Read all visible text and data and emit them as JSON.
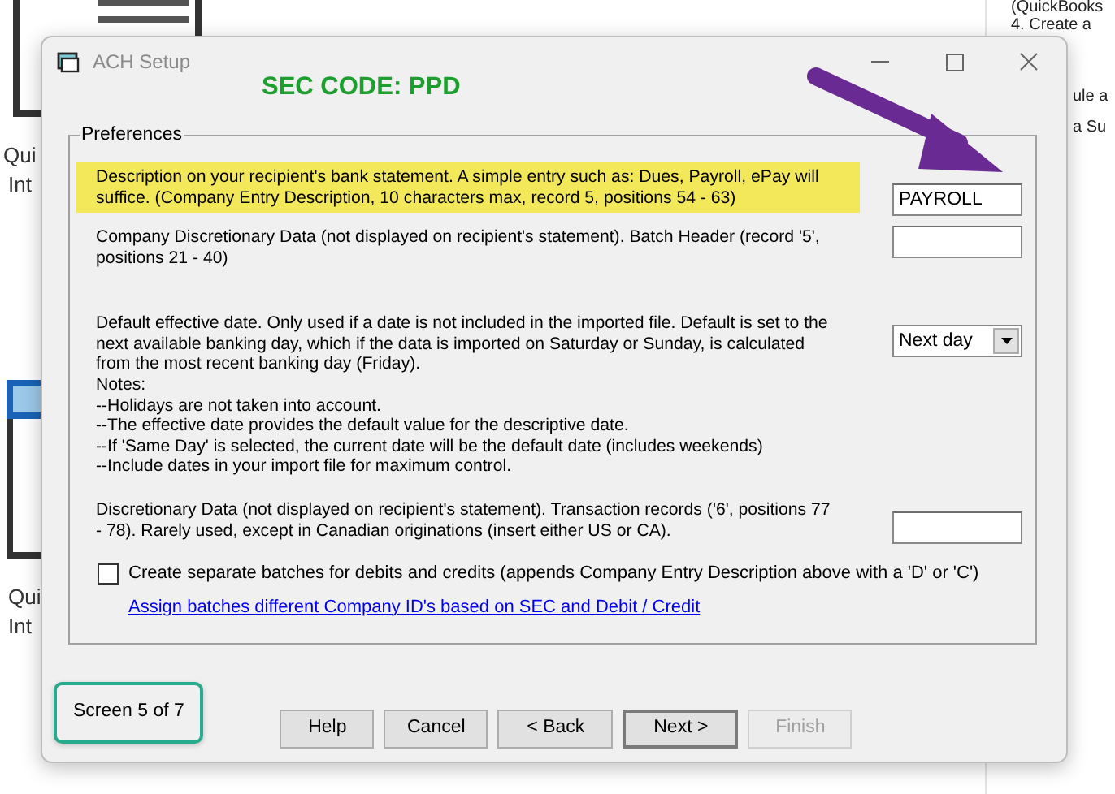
{
  "background_page": {
    "left_texts": [
      {
        "text": "Qui"
      },
      {
        "text": "Int"
      },
      {
        "text": "Qui"
      },
      {
        "text": "Int"
      }
    ],
    "right_texts": [
      {
        "text": "(QuickBooks"
      },
      {
        "text": "4. Create a"
      },
      {
        "text": "ule a"
      },
      {
        "text": "a Su"
      }
    ]
  },
  "window": {
    "title": "ACH Setup",
    "annotation": "SEC CODE: PPD",
    "group": {
      "title": "Preferences",
      "settings": [
        {
          "kind": "text",
          "highlighted": true,
          "description": "Description on your recipient's bank statement.  A simple entry such as: Dues, Payroll, ePay will suffice.  (Company Entry Description, 10 characters max, record 5, positions 54 - 63)",
          "value": "PAYROLL"
        },
        {
          "kind": "text",
          "highlighted": false,
          "description": "Company Discretionary Data (not displayed on recipient's statement). Batch Header (record '5', positions 21 - 40)"
        },
        {
          "kind": "select",
          "highlighted": false,
          "description": "Default effective date.  Only used if a date is not included in the imported file. Default is set to the next available banking day, which if the data is imported on Saturday or Sunday, is calculated from the most recent banking day (Friday).",
          "notes": [
            "Notes:",
            "--Holidays are not taken into account.",
            "--The effective date provides the default value for the descriptive date.",
            "--If 'Same Day' is selected, the current date will be the default date (includes weekends)",
            "--Include dates in your import file for maximum control."
          ],
          "value": "Next day"
        },
        {
          "kind": "text",
          "highlighted": false,
          "description": "Discretionary Data (not displayed on recipient's statement). Transaction records ('6', positions 77 - 78).  Rarely used, except in Canadian originations (insert either US or CA)."
        }
      ],
      "checkbox": {
        "label": "Create separate batches for debits and credits (appends Company Entry Description above with a 'D' or 'C')",
        "checked": false
      },
      "link": "Assign batches different Company ID's based on SEC and Debit / Credit"
    },
    "screen_indicator": "Screen 5 of 7",
    "buttons": [
      {
        "label": "Help",
        "disabled": false,
        "default": false
      },
      {
        "label": "Cancel",
        "disabled": false,
        "default": false
      },
      {
        "label": "< Back",
        "disabled": false,
        "default": false
      },
      {
        "label": "Next >",
        "disabled": false,
        "default": true
      },
      {
        "label": "Finish",
        "disabled": true,
        "default": false
      }
    ]
  }
}
